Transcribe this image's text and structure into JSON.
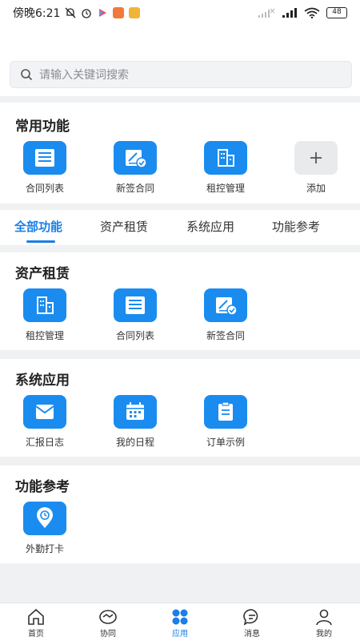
{
  "status_bar": {
    "time": "傍晚6:21",
    "battery": "48"
  },
  "search": {
    "placeholder": "请输入关键词搜索"
  },
  "common": {
    "title": "常用功能",
    "items": [
      {
        "label": "合同列表",
        "icon": "document-list-icon"
      },
      {
        "label": "新签合同",
        "icon": "contract-sign-icon"
      },
      {
        "label": "租控管理",
        "icon": "building-icon"
      },
      {
        "label": "添加",
        "icon": "plus-icon"
      }
    ]
  },
  "tabs": {
    "items": [
      "全部功能",
      "资产租赁",
      "系统应用",
      "功能参考"
    ],
    "active_index": 0
  },
  "asset": {
    "title": "资产租赁",
    "items": [
      {
        "label": "租控管理",
        "icon": "building-icon"
      },
      {
        "label": "合同列表",
        "icon": "document-list-icon"
      },
      {
        "label": "新签合同",
        "icon": "contract-sign-icon"
      }
    ]
  },
  "system": {
    "title": "系统应用",
    "items": [
      {
        "label": "汇报日志",
        "icon": "mail-icon"
      },
      {
        "label": "我的日程",
        "icon": "calendar-icon"
      },
      {
        "label": "订单示例",
        "icon": "clipboard-icon"
      }
    ]
  },
  "reference": {
    "title": "功能参考",
    "items": [
      {
        "label": "外勤打卡",
        "icon": "location-clock-icon"
      }
    ]
  },
  "bottom_nav": {
    "items": [
      {
        "label": "首页",
        "icon": "home-icon"
      },
      {
        "label": "协同",
        "icon": "handshake-icon"
      },
      {
        "label": "应用",
        "icon": "apps-icon"
      },
      {
        "label": "消息",
        "icon": "message-icon"
      },
      {
        "label": "我的",
        "icon": "user-icon"
      }
    ],
    "active_index": 2
  },
  "colors": {
    "accent": "#1a8cf0",
    "active_text": "#1a7fe6",
    "page_bg": "#f0f1f3"
  }
}
